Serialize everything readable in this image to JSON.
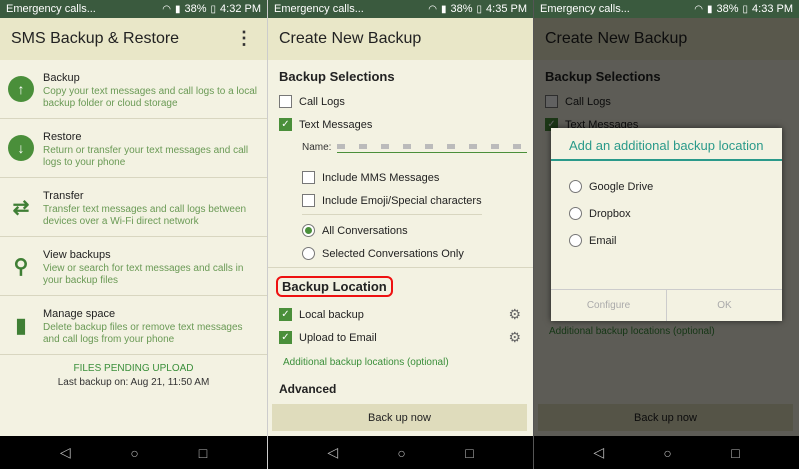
{
  "status": {
    "p1": {
      "carrier": "Emergency calls...",
      "battery": "38%",
      "time": "4:32 PM"
    },
    "p2": {
      "carrier": "Emergency calls...",
      "battery": "38%",
      "time": "4:35 PM"
    },
    "p3": {
      "carrier": "Emergency calls...",
      "battery": "38%",
      "time": "4:33 PM"
    }
  },
  "home": {
    "title": "SMS Backup & Restore",
    "items": [
      {
        "title": "Backup",
        "desc": "Copy your text messages and call logs to a local backup folder or cloud storage",
        "icon": "upload-icon"
      },
      {
        "title": "Restore",
        "desc": "Return or transfer your text messages and call logs to your phone",
        "icon": "download-icon"
      },
      {
        "title": "Transfer",
        "desc": "Transfer text messages and call logs between devices over a Wi-Fi direct network",
        "icon": "transfer-icon"
      },
      {
        "title": "View backups",
        "desc": "View or search for text messages and calls in your backup files",
        "icon": "search-icon"
      },
      {
        "title": "Manage space",
        "desc": "Delete backup files or remove text messages and call logs from your phone",
        "icon": "trash-icon"
      }
    ],
    "pending": "FILES PENDING UPLOAD",
    "last_backup": "Last backup on: Aug 21, 11:50 AM"
  },
  "create": {
    "title": "Create New Backup",
    "selections_title": "Backup Selections",
    "call_logs": "Call Logs",
    "text_messages": "Text Messages",
    "name_label": "Name:",
    "include_mms": "Include MMS Messages",
    "include_emoji": "Include Emoji/Special characters",
    "all_conversations": "All Conversations",
    "selected_conversations": "Selected Conversations Only",
    "location_title": "Backup Location",
    "local_backup": "Local backup",
    "upload_email": "Upload to Email",
    "additional_link": "Additional backup locations (optional)",
    "advanced": "Advanced",
    "backup_button": "Back up now"
  },
  "dialog": {
    "title": "Add an additional backup location",
    "options": [
      "Google Drive",
      "Dropbox",
      "Email"
    ],
    "configure": "Configure",
    "ok": "OK"
  },
  "colors": {
    "accent": "#4a8f3a",
    "dialog_accent": "#2a9a8a",
    "highlight": "#ee1111"
  }
}
